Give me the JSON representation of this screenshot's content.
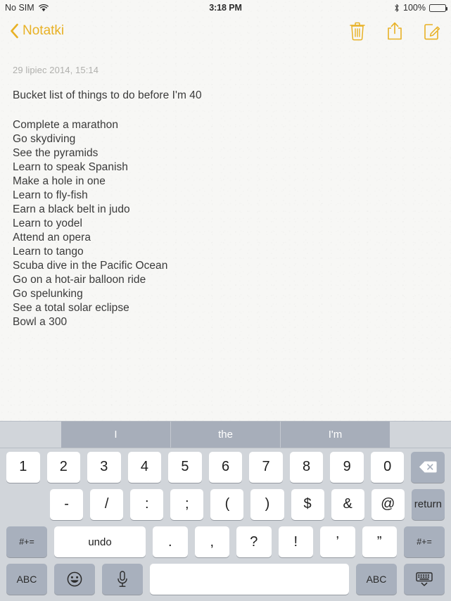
{
  "status_bar": {
    "carrier": "No SIM",
    "wifi_icon": "wifi-icon",
    "time": "3:18 PM",
    "bluetooth_icon": "bluetooth-icon",
    "battery_percent": "100%",
    "battery_level": 100
  },
  "nav_bar": {
    "back_label": "Notatki",
    "back_icon": "chevron-left-icon",
    "actions": [
      {
        "name": "trash-icon",
        "label": "Delete"
      },
      {
        "name": "share-icon",
        "label": "Share"
      },
      {
        "name": "compose-icon",
        "label": "Compose"
      }
    ],
    "accent_color": "#e8b125"
  },
  "note": {
    "date": "29 lipiec 2014, 15:14",
    "title": "Bucket list of things to do before I'm 40",
    "items": [
      "Complete a marathon",
      "Go skydiving",
      "See the pyramids",
      "Learn to speak Spanish",
      "Make a hole in one",
      "Learn to fly-fish",
      "Earn a black belt in judo",
      "Learn to yodel",
      "Attend an opera",
      "Learn to tango",
      "Scuba dive in the Pacific Ocean",
      "Go on a hot-air balloon ride",
      "Go spelunking",
      "See a total solar eclipse",
      "Bowl a 300"
    ],
    "paper_color": "#f7f7f5",
    "text_color": "#3a3a3a",
    "date_color": "#b0b0ad"
  },
  "keyboard": {
    "background_color": "#d1d5da",
    "key_color": "#ffffff",
    "dark_key_color": "#a8b0bd",
    "predictions": [
      "I",
      "the",
      "I'm"
    ],
    "row_numbers": [
      "1",
      "2",
      "3",
      "4",
      "5",
      "6",
      "7",
      "8",
      "9",
      "0"
    ],
    "delete_icon": "backspace-icon",
    "row_symbols": [
      "-",
      "/",
      ":",
      ";",
      "(",
      ")",
      "$",
      "&",
      "@"
    ],
    "return_label": "return",
    "row_punct": {
      "shift_left_label": "#+=",
      "undo_label": "undo",
      "keys": [
        ".",
        ",",
        "?",
        "!",
        "’",
        "”"
      ],
      "shift_right_label": "#+="
    },
    "row_bottom": {
      "abc_left_label": "ABC",
      "emoji_icon": "emoji-smiley-icon",
      "mic_icon": "microphone-icon",
      "space_label": "",
      "abc_right_label": "ABC",
      "hide_keyboard_icon": "hide-keyboard-icon"
    }
  }
}
